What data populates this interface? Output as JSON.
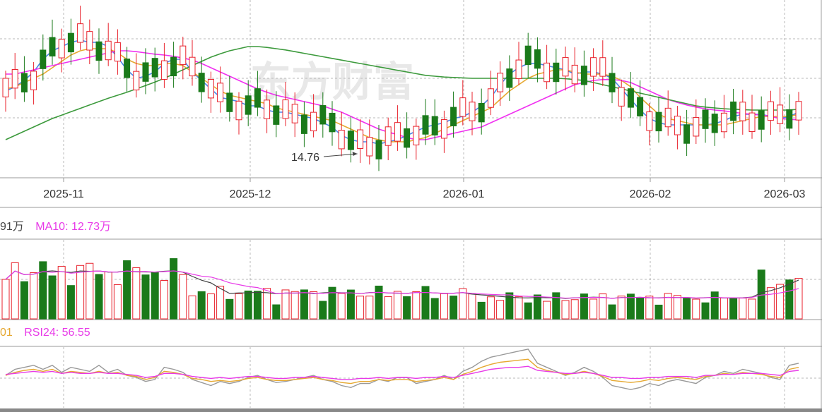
{
  "colors": {
    "up": "#e8212b",
    "down": "#1a7a1a",
    "ma5": "#4a86e8",
    "ma10": "#e6a830",
    "ma20": "#f030f0",
    "ma60": "#3c9a3c",
    "grid": "#b8b8b8",
    "axis_text": "#333333",
    "rsi6": "#999999",
    "rsi12": "#e6a830",
    "rsi24": "#e83ae8",
    "vol_ma5": "#444444",
    "vol_ma10": "#e83ae8",
    "watermark": "#e6e6e6"
  },
  "watermark_text": "东方财富",
  "chart_data": [
    {
      "type": "candlestick",
      "x_labels": [
        "2025-11",
        "2025-12",
        "2026-01",
        "2026-02",
        "2026-03"
      ],
      "label_indices": [
        7,
        27,
        50,
        70,
        84
      ],
      "annotation": {
        "text": "14.76",
        "index": 38,
        "value": 14.76
      },
      "ylim": [
        14.1,
        18.3
      ],
      "ma_series": [
        {
          "key": "ma5",
          "values": [
            16.15,
            16.25,
            16.4,
            16.6,
            16.9,
            17.1,
            17.2,
            17.3,
            17.35,
            17.3,
            17.3,
            17.2,
            16.95,
            16.65,
            16.45,
            16.5,
            16.6,
            16.8,
            16.9,
            16.9,
            16.6,
            16.4,
            16.2,
            16.0,
            15.95,
            15.9,
            15.8,
            15.8,
            15.7,
            15.65,
            15.65,
            15.6,
            15.55,
            15.5,
            15.4,
            15.3,
            15.1,
            15.0,
            14.95,
            14.95,
            14.9,
            14.95,
            15.0,
            15.1,
            15.2,
            15.3,
            15.35,
            15.4,
            15.5,
            15.55,
            15.65,
            15.8,
            16.0,
            16.3,
            16.55,
            16.7,
            16.8,
            16.8,
            16.75,
            16.7,
            16.65,
            16.55,
            16.6,
            16.6,
            16.55,
            16.45,
            16.2,
            15.95,
            15.7,
            15.5,
            15.4,
            15.35,
            15.35,
            15.35,
            15.35,
            15.35,
            15.38,
            15.45,
            15.55,
            15.6,
            15.6,
            15.6,
            15.55,
            15.5,
            15.55,
            15.65
          ]
        },
        {
          "key": "ma10",
          "values": [
            16.2,
            16.25,
            16.35,
            16.45,
            16.55,
            16.7,
            16.85,
            17.0,
            17.1,
            17.15,
            17.15,
            17.15,
            17.05,
            16.9,
            16.8,
            16.75,
            16.75,
            16.8,
            16.8,
            16.75,
            16.6,
            16.45,
            16.3,
            16.15,
            16.05,
            16.0,
            15.95,
            15.9,
            15.85,
            15.75,
            15.7,
            15.65,
            15.6,
            15.55,
            15.5,
            15.45,
            15.35,
            15.25,
            15.15,
            15.05,
            15.0,
            14.95,
            14.95,
            14.95,
            15.0,
            15.05,
            15.15,
            15.25,
            15.35,
            15.45,
            15.55,
            15.65,
            15.75,
            15.95,
            16.15,
            16.3,
            16.45,
            16.55,
            16.6,
            16.65,
            16.65,
            16.6,
            16.55,
            16.55,
            16.55,
            16.5,
            16.4,
            16.25,
            16.0,
            15.8,
            15.6,
            15.5,
            15.45,
            15.4,
            15.35,
            15.35,
            15.35,
            15.35,
            15.4,
            15.45,
            15.5,
            15.55,
            15.55,
            15.55,
            15.55,
            15.6
          ]
        },
        {
          "key": "ma20",
          "values": [
            16.55,
            16.55,
            16.6,
            16.65,
            16.7,
            16.75,
            16.8,
            16.85,
            16.9,
            16.95,
            17.0,
            17.05,
            17.1,
            17.1,
            17.08,
            17.05,
            17.02,
            17.0,
            16.97,
            16.93,
            16.88,
            16.8,
            16.7,
            16.6,
            16.5,
            16.4,
            16.3,
            16.2,
            16.12,
            16.05,
            16.0,
            15.95,
            15.9,
            15.85,
            15.8,
            15.72,
            15.65,
            15.55,
            15.45,
            15.35,
            15.25,
            15.18,
            15.12,
            15.05,
            15.0,
            15.0,
            15.05,
            15.1,
            15.15,
            15.2,
            15.25,
            15.3,
            15.4,
            15.5,
            15.6,
            15.7,
            15.8,
            15.9,
            16.0,
            16.1,
            16.2,
            16.3,
            16.35,
            16.4,
            16.42,
            16.42,
            16.4,
            16.35,
            16.25,
            16.15,
            16.05,
            15.95,
            15.88,
            15.82,
            15.77,
            15.73,
            15.7,
            15.68,
            15.65,
            15.62,
            15.6,
            15.58,
            15.55,
            15.5,
            15.48,
            15.47
          ]
        },
        {
          "key": "ma60",
          "values": [
            15.0,
            15.1,
            15.2,
            15.3,
            15.4,
            15.5,
            15.58,
            15.66,
            15.74,
            15.82,
            15.9,
            15.98,
            16.05,
            16.12,
            16.2,
            16.28,
            16.36,
            16.45,
            16.55,
            16.65,
            16.75,
            16.85,
            16.95,
            17.03,
            17.1,
            17.15,
            17.2,
            17.2,
            17.18,
            17.15,
            17.12,
            17.08,
            17.04,
            17.0,
            16.96,
            16.92,
            16.88,
            16.84,
            16.8,
            16.76,
            16.72,
            16.68,
            16.64,
            16.6,
            16.56,
            16.52,
            16.5,
            16.48,
            16.47,
            16.46,
            16.45,
            16.45,
            16.45,
            16.45,
            16.45,
            16.45,
            16.45,
            16.45,
            16.45,
            16.45,
            16.44,
            16.42,
            16.4,
            16.35,
            16.3,
            16.25,
            16.2,
            16.15,
            16.1,
            16.05,
            16.0,
            15.95,
            15.9,
            15.85,
            15.8,
            15.77,
            15.75,
            15.73,
            15.72,
            15.71,
            15.7,
            15.7,
            15.7,
            15.7,
            15.7,
            15.72
          ]
        }
      ]
    },
    {
      "type": "bar",
      "title": "",
      "legend": [
        {
          "text": "91万",
          "color": "vol_ma5"
        },
        {
          "text": "MA10: 12.73万",
          "color": "vol_ma10"
        }
      ],
      "ylim": [
        0,
        30
      ]
    },
    {
      "type": "line",
      "legend": [
        {
          "text": "01",
          "color": "rsi12"
        },
        {
          "text": "RSI24: 56.55",
          "color": "rsi24"
        }
      ],
      "ylim": [
        20,
        80
      ],
      "series": [
        {
          "key": "rsi6",
          "values": [
            52,
            58,
            60,
            62,
            58,
            62,
            55,
            60,
            58,
            56,
            62,
            55,
            58,
            52,
            50,
            46,
            48,
            60,
            58,
            55,
            48,
            45,
            42,
            46,
            44,
            46,
            50,
            52,
            48,
            45,
            46,
            48,
            50,
            52,
            48,
            46,
            42,
            40,
            44,
            44,
            48,
            46,
            50,
            50,
            44,
            46,
            48,
            52,
            48,
            56,
            60,
            66,
            70,
            72,
            74,
            76,
            78,
            64,
            60,
            56,
            52,
            55,
            60,
            56,
            50,
            42,
            40,
            38,
            40,
            44,
            42,
            46,
            48,
            46,
            44,
            50,
            52,
            56,
            54,
            58,
            56,
            54,
            50,
            48,
            62,
            64
          ]
        },
        {
          "key": "rsi12",
          "values": [
            52,
            55,
            57,
            58,
            56,
            58,
            54,
            56,
            55,
            54,
            56,
            54,
            55,
            52,
            51,
            48,
            50,
            56,
            55,
            53,
            49,
            48,
            46,
            47,
            46,
            47,
            49,
            50,
            48,
            47,
            47,
            48,
            49,
            50,
            48,
            47,
            45,
            44,
            46,
            46,
            48,
            47,
            48,
            48,
            46,
            47,
            48,
            50,
            48,
            53,
            56,
            60,
            63,
            65,
            66,
            67,
            68,
            60,
            57,
            55,
            53,
            54,
            56,
            54,
            51,
            47,
            46,
            45,
            46,
            48,
            47,
            49,
            50,
            49,
            48,
            51,
            52,
            54,
            53,
            55,
            54,
            53,
            51,
            50,
            58,
            60
          ]
        },
        {
          "key": "rsi24",
          "values": [
            53,
            54,
            55,
            56,
            55,
            56,
            54,
            55,
            54,
            54,
            55,
            54,
            54,
            53,
            52,
            50,
            51,
            54,
            54,
            53,
            51,
            50,
            49,
            50,
            49,
            50,
            51,
            51,
            50,
            49,
            49,
            50,
            50,
            51,
            50,
            49,
            48,
            48,
            49,
            49,
            50,
            49,
            50,
            50,
            49,
            50,
            50,
            51,
            50,
            52,
            54,
            56,
            58,
            59,
            60,
            60,
            61,
            57,
            56,
            55,
            54,
            54,
            55,
            54,
            52,
            50,
            50,
            49,
            49,
            50,
            50,
            51,
            51,
            51,
            50,
            52,
            52,
            53,
            53,
            54,
            54,
            54,
            53,
            52,
            56,
            57
          ]
        }
      ]
    }
  ]
}
